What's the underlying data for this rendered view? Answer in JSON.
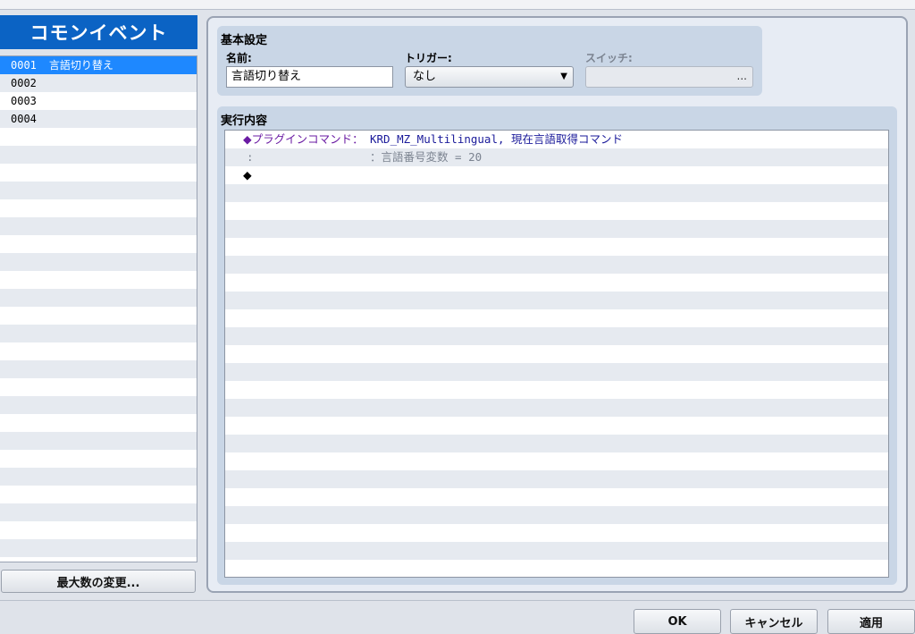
{
  "left_panel": {
    "title": "コモンイベント",
    "events": [
      {
        "id": "0001",
        "name": "言語切り替え",
        "selected": true
      },
      {
        "id": "0002",
        "name": ""
      },
      {
        "id": "0003",
        "name": ""
      },
      {
        "id": "0004",
        "name": ""
      }
    ],
    "max_button": "最大数の変更..."
  },
  "basic_settings": {
    "title": "基本設定",
    "name_label": "名前:",
    "name_value": "言語切り替え",
    "trigger_label": "トリガー:",
    "trigger_value": "なし",
    "switch_label": "スイッチ:",
    "switch_button": "..."
  },
  "contents": {
    "title": "実行内容",
    "row1_command": "◆プラグインコマンド：",
    "row1_args": "KRD_MZ_Multilingual, 現在言語取得コマンド",
    "row2_cont": ":",
    "row2_args": "：言語番号変数 = 20",
    "row3_empty": "◆"
  },
  "footer": {
    "ok": "OK",
    "cancel": "キャンセル",
    "apply": "適用"
  }
}
